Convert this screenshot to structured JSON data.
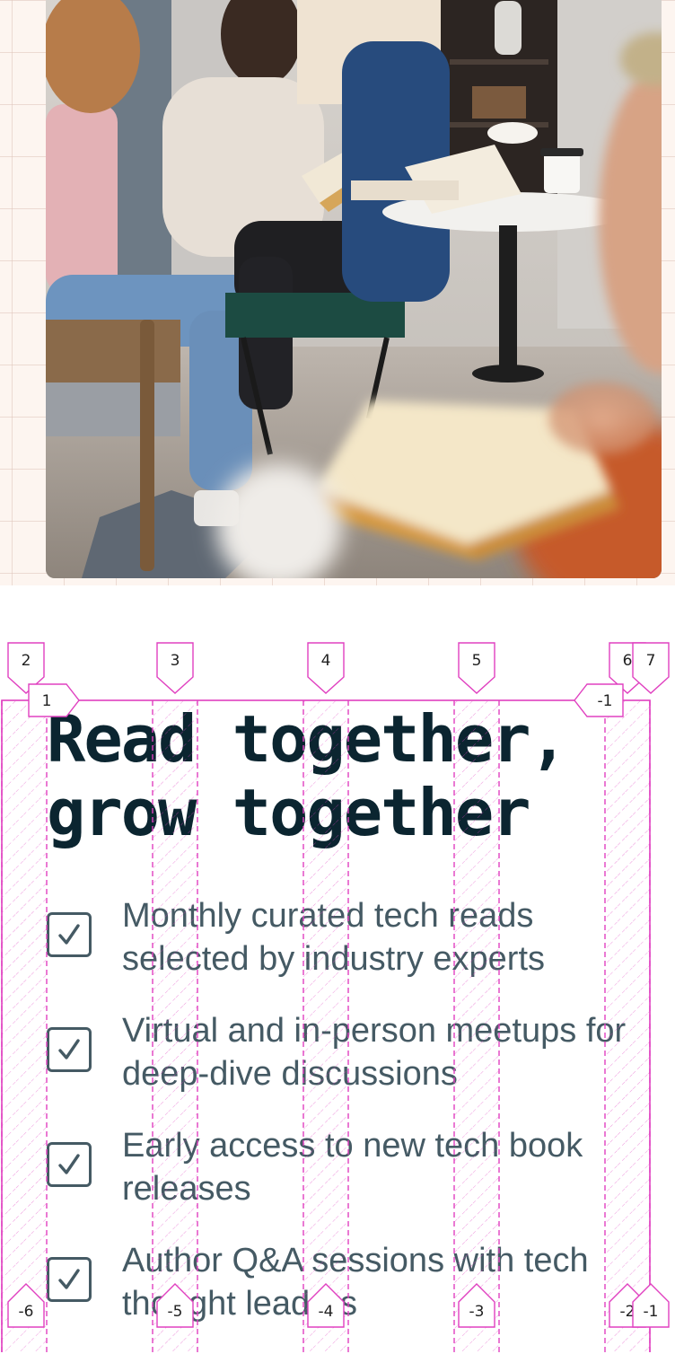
{
  "hero": {
    "image_alt": "Group of people reading books together around a café table"
  },
  "heading": {
    "line1": "Read together,",
    "line2": "grow together"
  },
  "features": [
    {
      "text": "Monthly curated tech reads selected by industry experts",
      "icon": "check-icon"
    },
    {
      "text": "Virtual and in-person meetups for deep-dive discussions",
      "icon": "check-icon"
    },
    {
      "text": "Early access to new tech book releases",
      "icon": "check-icon"
    },
    {
      "text": "Author Q&A sessions with tech thought leaders",
      "icon": "check-icon"
    }
  ],
  "grid_overlay": {
    "top_labels": [
      "2",
      "3",
      "4",
      "5",
      "6",
      "7"
    ],
    "start_label": "1",
    "end_label": "-1",
    "bottom_labels": [
      "-6",
      "-5",
      "-4",
      "-3",
      "-2",
      "-1"
    ],
    "color": "#e040c0"
  },
  "colors": {
    "heading": "#0b2530",
    "body_text": "#455a64",
    "hero_bg": "#fdf5f0"
  }
}
